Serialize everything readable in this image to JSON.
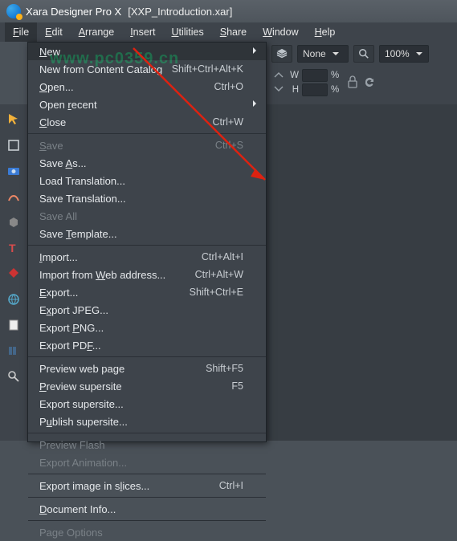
{
  "titlebar": {
    "app": "Xara Designer Pro X",
    "file": "[XXP_Introduction.xar]"
  },
  "menubar": {
    "items": [
      {
        "label": "File",
        "u": 0
      },
      {
        "label": "Edit",
        "u": 0
      },
      {
        "label": "Arrange",
        "u": 0
      },
      {
        "label": "Insert",
        "u": 0
      },
      {
        "label": "Utilities",
        "u": 0
      },
      {
        "label": "Share",
        "u": 0
      },
      {
        "label": "Window",
        "u": 0
      },
      {
        "label": "Help",
        "u": 0
      }
    ]
  },
  "dropdown": {
    "groups": [
      [
        {
          "label": "New",
          "u": 0,
          "submenu": true,
          "highlight": true
        },
        {
          "label": "New from Content Catalog",
          "shortcut": "Shift+Ctrl+Alt+K"
        },
        {
          "label": "Open...",
          "u": 0,
          "shortcut": "Ctrl+O"
        },
        {
          "label": "Open recent",
          "u": 5,
          "submenu": true
        },
        {
          "label": "Close",
          "u": 0,
          "shortcut": "Ctrl+W"
        }
      ],
      [
        {
          "label": "Save",
          "u": 0,
          "shortcut": "Ctrl+S",
          "disabled": true
        },
        {
          "label": "Save As...",
          "u": 5
        },
        {
          "label": "Load Translation..."
        },
        {
          "label": "Save Translation..."
        },
        {
          "label": "Save All",
          "disabled": true
        },
        {
          "label": "Save Template...",
          "u": 5
        }
      ],
      [
        {
          "label": "Import...",
          "u": 0,
          "shortcut": "Ctrl+Alt+I"
        },
        {
          "label": "Import from Web address...",
          "u": 12,
          "shortcut": "Ctrl+Alt+W"
        },
        {
          "label": "Export...",
          "u": 0,
          "shortcut": "Shift+Ctrl+E"
        },
        {
          "label": "Export JPEG...",
          "u": 1
        },
        {
          "label": "Export PNG...",
          "u": 7
        },
        {
          "label": "Export PDF...",
          "u": 9
        }
      ],
      [
        {
          "label": "Preview web page",
          "shortcut": "Shift+F5"
        },
        {
          "label": "Preview supersite",
          "u": 0,
          "shortcut": "F5"
        },
        {
          "label": "Export supersite..."
        },
        {
          "label": "Publish supersite...",
          "u": 1
        }
      ],
      [
        {
          "label": "Preview Flash",
          "disabled": true
        },
        {
          "label": "Export Animation...",
          "disabled": true
        }
      ],
      [
        {
          "label": "Export image in slices...",
          "u": 17,
          "shortcut": "Ctrl+I"
        }
      ],
      [
        {
          "label": "Document Info...",
          "u": 0
        }
      ],
      [
        {
          "label": "Page Options",
          "disabled": true
        }
      ]
    ]
  },
  "toolbar": {
    "fill": "None",
    "zoom": "100%",
    "w_label": "W",
    "h_label": "H",
    "pct": "%"
  },
  "icons": {
    "layers": "layers-icon",
    "magnify": "magnify-icon",
    "lock": "lock-icon",
    "refresh": "refresh-icon",
    "arrow_pair": "arrow-pair-icon"
  },
  "watermark": "www.pc0359.cn"
}
